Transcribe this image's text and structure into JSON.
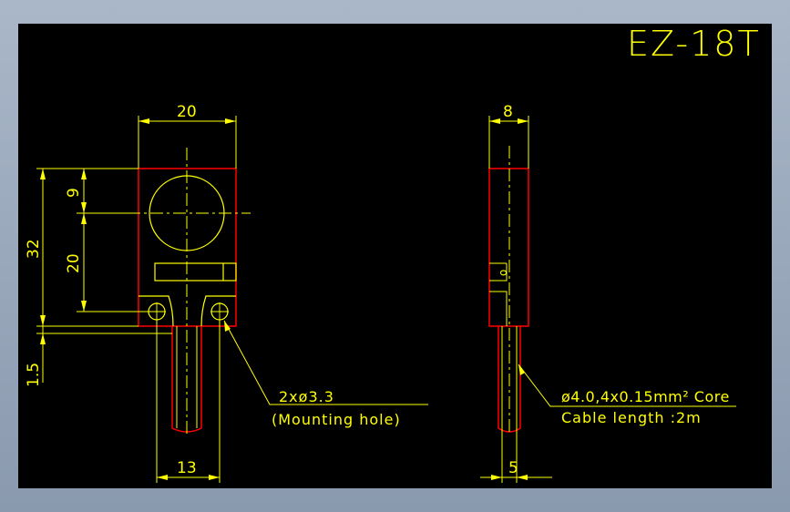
{
  "title": "EZ-18T",
  "colors": {
    "background": "#000000",
    "outline": "#ff0000",
    "detail": "#ffff00",
    "frame": "#8e9db3"
  },
  "front_view": {
    "dim_width": "20",
    "dim_top_to_center": "9",
    "dim_center_to_holes": "20",
    "dim_height": "32",
    "dim_offset": "1.5",
    "dim_stem_width": "13",
    "hole_note": "2xø3.3",
    "hole_note_sub": "(Mounting hole)"
  },
  "side_view": {
    "dim_thickness": "8",
    "dim_cable": "5",
    "cable_note": "ø4.0,4x0.15mm² Core",
    "cable_note_sub": "Cable length :2m"
  }
}
